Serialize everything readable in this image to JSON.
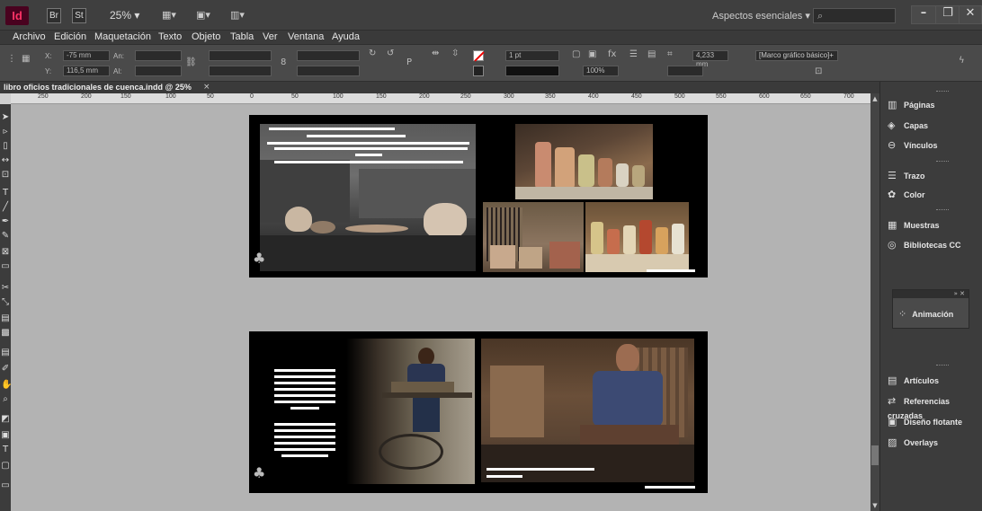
{
  "titlebar": {
    "app_logo": "Id",
    "bridge": "Br",
    "stock": "St",
    "zoom": "25% ▾",
    "workspace": "Aspectos esenciales ▾",
    "search_icon": "search-icon"
  },
  "menu": [
    "Archivo",
    "Edición",
    "Maquetación",
    "Texto",
    "Objeto",
    "Tabla",
    "Ver",
    "Ventana",
    "Ayuda"
  ],
  "control": {
    "x_label": "X:",
    "x_value": "-75 mm",
    "y_label": "Y:",
    "y_value": "116,5 mm",
    "w_label": "An:",
    "h_label": "Al:",
    "stroke_weight": "1 pt",
    "opacity": "100%",
    "offset": "4,233 mm",
    "frame_style": "[Marco gráfico básico]+"
  },
  "document": {
    "tab_label": "libro oficios tradicionales de cuenca.indd @ 25%",
    "close": "×"
  },
  "ruler_ticks": [
    "250",
    "200",
    "150",
    "100",
    "50",
    "0",
    "50",
    "100",
    "150",
    "200",
    "250",
    "300",
    "350",
    "400",
    "450",
    "500",
    "550",
    "600",
    "650",
    "700"
  ],
  "panels": {
    "group1": [
      "Páginas",
      "Capas",
      "Vínculos"
    ],
    "group2": [
      "Trazo",
      "Color"
    ],
    "group3": [
      "Muestras",
      "Bibliotecas CC"
    ],
    "animation": "Animación",
    "group4": [
      "Artículos",
      "Referencias cruzadas",
      "Diseño flotante",
      "Overlays"
    ]
  }
}
